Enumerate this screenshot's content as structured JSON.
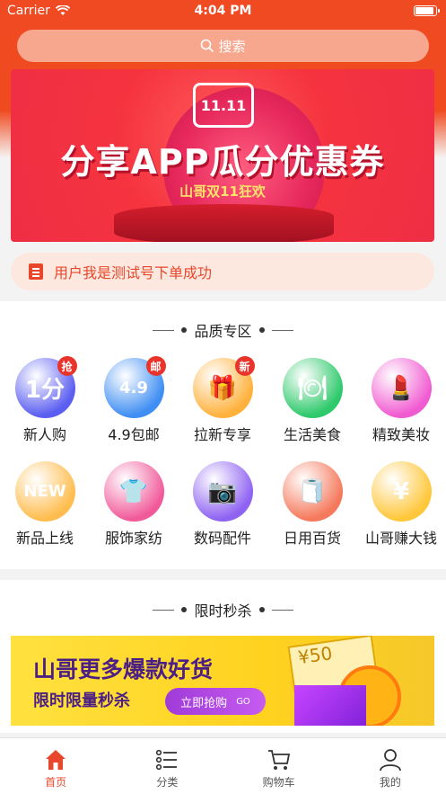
{
  "status_bar": {
    "carrier": "Carrier",
    "time": "4:04 PM",
    "battery_level": 0.95
  },
  "search": {
    "placeholder": "搜索",
    "icon": "search-icon"
  },
  "banner": {
    "title": "分享APP瓜分优惠券",
    "subtitle": "山哥双11狂欢",
    "badge": "11.11"
  },
  "notice": {
    "icon": "clipboard-icon",
    "text": "用户我是测试号下单成功"
  },
  "quality_section": {
    "title": "品质专区"
  },
  "categories": [
    {
      "label": "新人购",
      "icon": "new-user-icon",
      "glyph": "1分",
      "badge": "抢",
      "color": "#5b5ef0"
    },
    {
      "label": "4.9包邮",
      "icon": "free-shipping-icon",
      "glyph": "4.9",
      "badge": "邮",
      "color": "#3f8ef3"
    },
    {
      "label": "拉新专享",
      "icon": "gift-icon",
      "glyph": "🎁",
      "badge": "新",
      "color": "#ffb13c"
    },
    {
      "label": "生活美食",
      "icon": "food-icon",
      "glyph": "🍽",
      "badge": "",
      "color": "#2ec96b"
    },
    {
      "label": "精致美妆",
      "icon": "makeup-icon",
      "glyph": "💄",
      "badge": "",
      "color": "#f15bd1"
    },
    {
      "label": "新品上线",
      "icon": "new-arrival-icon",
      "glyph": "NEW",
      "badge": "",
      "color": "#ffbd4f"
    },
    {
      "label": "服饰家纺",
      "icon": "clothing-icon",
      "glyph": "👕",
      "badge": "",
      "color": "#f15a9a"
    },
    {
      "label": "数码配件",
      "icon": "camera-icon",
      "glyph": "📷",
      "badge": "",
      "color": "#8f63f2"
    },
    {
      "label": "日用百货",
      "icon": "tissue-icon",
      "glyph": "🧻",
      "badge": "",
      "color": "#f5795c"
    },
    {
      "label": "山哥赚大钱",
      "icon": "money-icon",
      "glyph": "¥",
      "badge": "",
      "color": "#ffc73a"
    }
  ],
  "flash_section": {
    "title": "限时秒杀",
    "banner_line1": "山哥更多爆款好货",
    "banner_line2": "限时限量秒杀",
    "button": "立即抢购",
    "button_tag": "GO",
    "coupon_text": "¥50"
  },
  "tabs": [
    {
      "label": "首页",
      "icon": "home-icon",
      "active": true
    },
    {
      "label": "分类",
      "icon": "list-icon",
      "active": false
    },
    {
      "label": "购物车",
      "icon": "cart-icon",
      "active": false
    },
    {
      "label": "我的",
      "icon": "user-icon",
      "active": false
    }
  ]
}
